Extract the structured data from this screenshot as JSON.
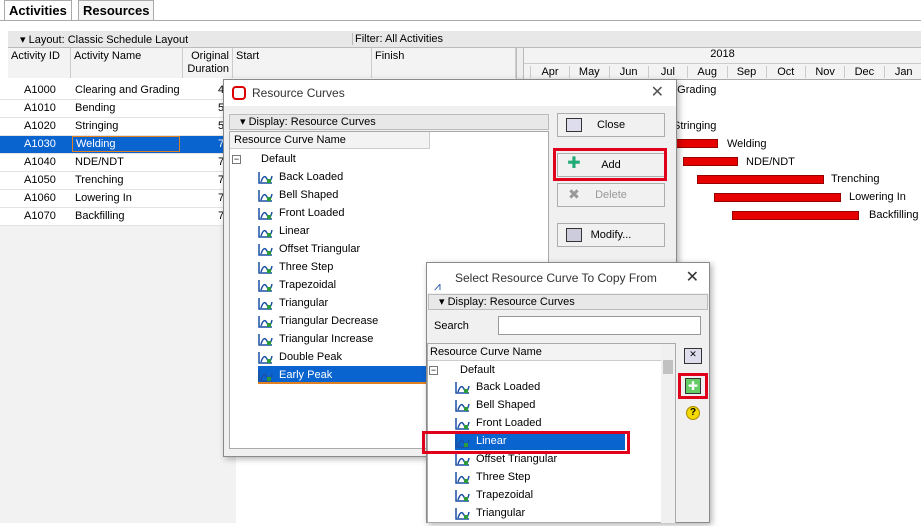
{
  "tabs": {
    "activities": "Activities",
    "resources": "Resources"
  },
  "layout_label": "Layout: Classic Schedule Layout",
  "filter_label": "Filter: All Activities",
  "columns": {
    "activity_id": "Activity ID",
    "activity_name": "Activity Name",
    "orig_dur": "Original Duration",
    "start": "Start",
    "finish": "Finish"
  },
  "activities": [
    {
      "id": "A1000",
      "name": "Clearing and Grading",
      "dur": "4"
    },
    {
      "id": "A1010",
      "name": "Bending",
      "dur": "5"
    },
    {
      "id": "A1020",
      "name": "Stringing",
      "dur": "5"
    },
    {
      "id": "A1030",
      "name": "Welding",
      "dur": "7"
    },
    {
      "id": "A1040",
      "name": "NDE/NDT",
      "dur": "7"
    },
    {
      "id": "A1050",
      "name": "Trenching",
      "dur": "7"
    },
    {
      "id": "A1060",
      "name": "Lowering In",
      "dur": "7"
    },
    {
      "id": "A1070",
      "name": "Backfilling",
      "dur": "7"
    }
  ],
  "gantt": {
    "year": "2018",
    "months": [
      "Apr",
      "May",
      "Jun",
      "Jul",
      "Aug",
      "Sep",
      "Oct",
      "Nov",
      "Dec",
      "Jan"
    ],
    "labels": {
      "clearing": "d Grading",
      "stringing": "Stringing",
      "welding": "Welding",
      "nde": "NDE/NDT",
      "trenching": "Trenching",
      "lowering": "Lowering In",
      "backfilling": "Backfilling"
    }
  },
  "rc_dialog": {
    "title": "Resource Curves",
    "display": "Display: Resource Curves",
    "col_header": "Resource Curve Name",
    "root": "Default",
    "items": [
      "Back Loaded",
      "Bell Shaped",
      "Front Loaded",
      "Linear",
      "Offset Triangular",
      "Three Step",
      "Trapezoidal",
      "Triangular",
      "Triangular Decrease",
      "Triangular Increase",
      "Double Peak",
      "Early Peak"
    ],
    "buttons": {
      "close": "Close",
      "add": "Add",
      "delete": "Delete",
      "modify": "Modify..."
    }
  },
  "copy_dialog": {
    "title": "Select Resource Curve To Copy From",
    "display": "Display: Resource Curves",
    "search_label": "Search",
    "search_value": "",
    "col_header": "Resource Curve Name",
    "root": "Default",
    "items": [
      "Back Loaded",
      "Bell Shaped",
      "Front Loaded",
      "Linear",
      "Offset Triangular",
      "Three Step",
      "Trapezoidal",
      "Triangular"
    ]
  }
}
